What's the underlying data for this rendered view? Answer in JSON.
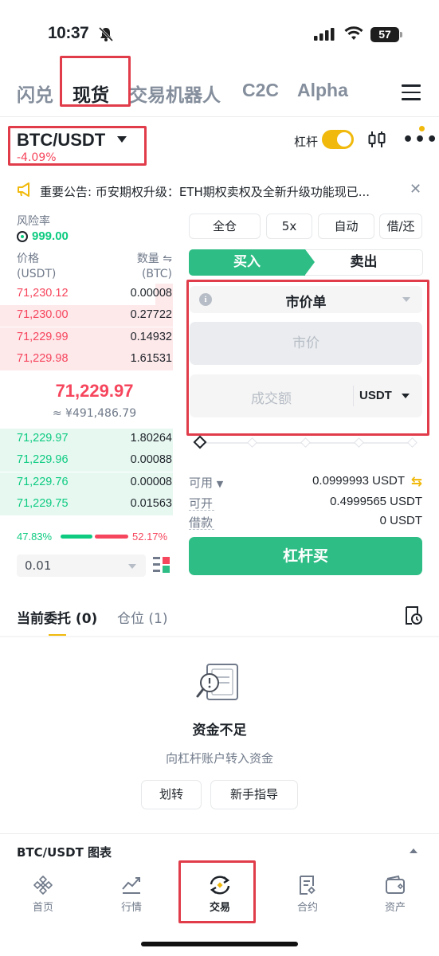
{
  "status_bar": {
    "time": "10:37",
    "battery": "57"
  },
  "top_tabs": [
    "闪兑",
    "现货",
    "交易机器人",
    "C2C",
    "Alpha"
  ],
  "pair": {
    "name": "BTC/USDT",
    "change": "-4.09%"
  },
  "lever": {
    "label": "杠杆",
    "enabled": true
  },
  "announcement": "重要公告: 币安期权升级：ETH期权卖权及全新升级功能现已...",
  "risk": {
    "label": "风险率",
    "value": "999.00"
  },
  "orderbook": {
    "price_header": "价格",
    "price_unit": "(USDT)",
    "qty_header": "数量 ⇋",
    "qty_unit": "(BTC)",
    "asks": [
      {
        "price": "71,230.12",
        "qty": "0.00008",
        "depth": 0.1
      },
      {
        "price": "71,230.00",
        "qty": "0.27722",
        "depth": 1.0
      },
      {
        "price": "71,229.99",
        "qty": "0.14932",
        "depth": 1.0
      },
      {
        "price": "71,229.98",
        "qty": "1.61531",
        "depth": 1.0
      }
    ],
    "mid_price": "71,229.97",
    "mid_fiat": "≈ ¥491,486.79",
    "bids": [
      {
        "price": "71,229.97",
        "qty": "1.80264",
        "depth": 1.0
      },
      {
        "price": "71,229.96",
        "qty": "0.00088",
        "depth": 1.0
      },
      {
        "price": "71,229.76",
        "qty": "0.00008",
        "depth": 1.0
      },
      {
        "price": "71,229.75",
        "qty": "0.01563",
        "depth": 1.0
      }
    ],
    "buy_ratio": "47.83%",
    "sell_ratio": "52.17%",
    "tick_size": "0.01"
  },
  "form": {
    "chips": [
      "全仓",
      "5x",
      "自动",
      "借/还"
    ],
    "buy_tab": "买入",
    "sell_tab": "卖出",
    "order_type": "市价单",
    "price_placeholder": "市价",
    "amount_placeholder": "成交额",
    "amount_unit": "USDT",
    "available_label": "可用",
    "available_value": "0.0999993 USDT",
    "openable_label": "可开",
    "openable_value": "0.4999565 USDT",
    "borrow_label": "借款",
    "borrow_value": "0 USDT",
    "submit": "杠杆买"
  },
  "orders": {
    "tab_open": "当前委托 (0)",
    "tab_positions": "仓位 (1)",
    "empty_title": "资金不足",
    "empty_sub": "向杠杆账户转入资金",
    "btn_transfer": "划转",
    "btn_guide": "新手指导"
  },
  "chart_bar": "BTC/USDT 图表",
  "nav": [
    "首页",
    "行情",
    "交易",
    "合约",
    "资产"
  ],
  "colors": {
    "green": "#2ebd85",
    "red": "#f6465d",
    "yellow": "#f0b90b",
    "highlight_box": "#e03c4a"
  }
}
